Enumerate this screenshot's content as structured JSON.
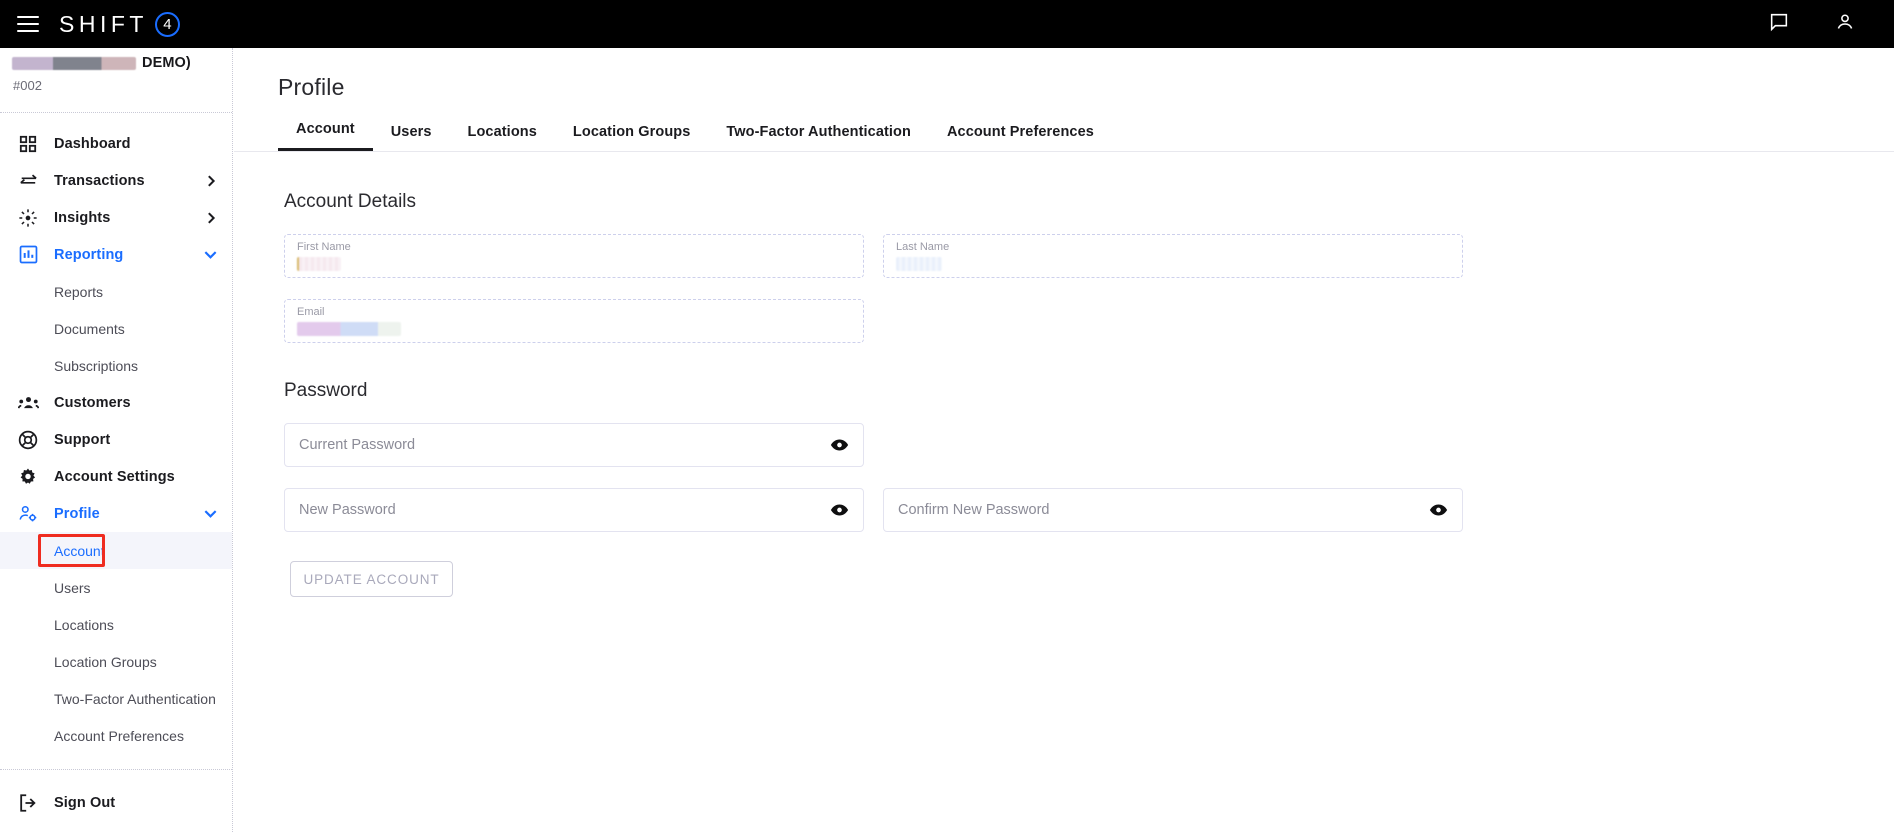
{
  "topbar": {
    "menu_icon": "hamburger-icon",
    "brand_text": "SHIFT",
    "brand_mark": "4",
    "chat_icon": "chat-bubble-icon",
    "user_icon": "user-account-icon"
  },
  "sidebar": {
    "account_name": "DEMO)",
    "account_id": "#002",
    "nav": [
      {
        "label": "Dashboard",
        "icon": "dashboard-grid-icon",
        "active": false,
        "chevron": ""
      },
      {
        "label": "Transactions",
        "icon": "transactions-arrows-icon",
        "active": false,
        "chevron": "right"
      },
      {
        "label": "Insights",
        "icon": "insights-sparkle-icon",
        "active": false,
        "chevron": "right"
      },
      {
        "label": "Reporting",
        "icon": "reporting-chart-icon",
        "active": true,
        "chevron": "down"
      }
    ],
    "reporting_children": [
      {
        "label": "Reports"
      },
      {
        "label": "Documents"
      },
      {
        "label": "Subscriptions"
      }
    ],
    "nav2": [
      {
        "label": "Customers",
        "icon": "customers-people-icon",
        "active": false,
        "chevron": ""
      },
      {
        "label": "Support",
        "icon": "support-lifering-icon",
        "active": false,
        "chevron": ""
      },
      {
        "label": "Account Settings",
        "icon": "gear-icon",
        "active": false,
        "chevron": ""
      },
      {
        "label": "Profile",
        "icon": "profile-person-gear-icon",
        "active": true,
        "chevron": "down"
      }
    ],
    "profile_children": [
      {
        "label": "Account",
        "current": true,
        "highlighted": true
      },
      {
        "label": "Users",
        "current": false,
        "highlighted": false
      },
      {
        "label": "Locations",
        "current": false,
        "highlighted": false
      },
      {
        "label": "Location Groups",
        "current": false,
        "highlighted": false
      },
      {
        "label": "Two-Factor Authentication",
        "current": false,
        "highlighted": false
      },
      {
        "label": "Account Preferences",
        "current": false,
        "highlighted": false
      }
    ],
    "sign_out": {
      "label": "Sign Out",
      "icon": "sign-out-icon"
    }
  },
  "main": {
    "page_title": "Profile",
    "tabs": [
      {
        "label": "Account",
        "active": true
      },
      {
        "label": "Users",
        "active": false
      },
      {
        "label": "Locations",
        "active": false
      },
      {
        "label": "Location Groups",
        "active": false
      },
      {
        "label": "Two-Factor Authentication",
        "active": false
      },
      {
        "label": "Account Preferences",
        "active": false
      }
    ],
    "account_details": {
      "heading": "Account Details",
      "first_name": {
        "label": "First Name",
        "value": "",
        "redacted": true
      },
      "last_name": {
        "label": "Last Name",
        "value": "",
        "redacted": true
      },
      "email": {
        "label": "Email",
        "value": "",
        "redacted": true
      }
    },
    "password": {
      "heading": "Password",
      "current_password": {
        "placeholder": "Current Password",
        "value": "",
        "toggle_icon": "eye-icon"
      },
      "new_password": {
        "placeholder": "New Password",
        "value": "",
        "toggle_icon": "eye-icon"
      },
      "confirm_password": {
        "placeholder": "Confirm New Password",
        "value": "",
        "toggle_icon": "eye-icon"
      }
    },
    "update_button": "UPDATE ACCOUNT"
  },
  "colors": {
    "accent_blue": "#1a6dff",
    "highlight_red": "#ef2c20",
    "topbar_black": "#000000",
    "text_dark": "#1b1b1f",
    "muted": "#8b8b97"
  }
}
